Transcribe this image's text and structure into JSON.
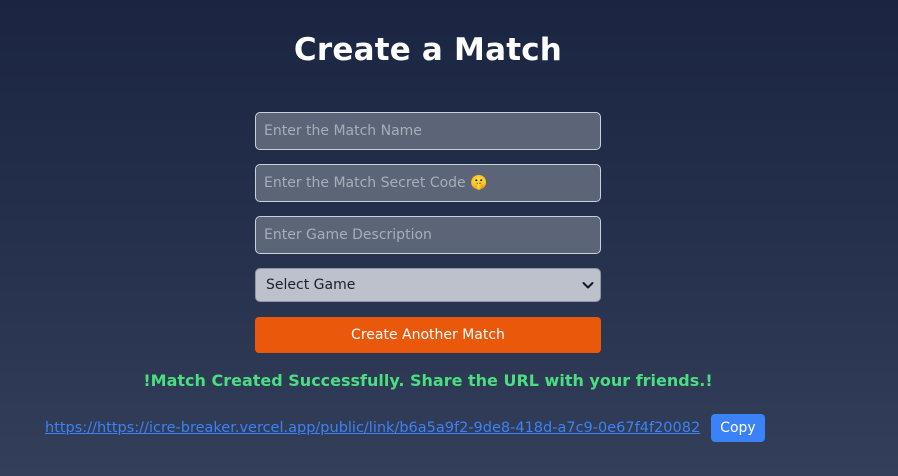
{
  "page": {
    "title": "Create a Match"
  },
  "form": {
    "match_name": {
      "value": "",
      "placeholder": "Enter the Match Name"
    },
    "secret_code": {
      "value": "",
      "placeholder": "Enter the Match Secret Code 🤫"
    },
    "description": {
      "value": "",
      "placeholder": "Enter Game Description"
    },
    "game_select": {
      "selected": "Select Game"
    },
    "submit_label": "Create Another Match"
  },
  "result": {
    "message": "!Match Created Successfully. Share the URL with your friends.!",
    "url": "https://https://icre-breaker.vercel.app/public/link/b6a5a9f2-9de8-418d-a7c9-0e67f4f20082",
    "copy_label": "Copy"
  },
  "colors": {
    "background_top": "#1b2542",
    "background_bottom": "#343f5a",
    "primary_button": "#ea580c",
    "success": "#4ade80",
    "link": "#3b82f6",
    "copy_button": "#3b82f6"
  },
  "icons": {
    "select_arrow": "chevron-down-icon"
  }
}
